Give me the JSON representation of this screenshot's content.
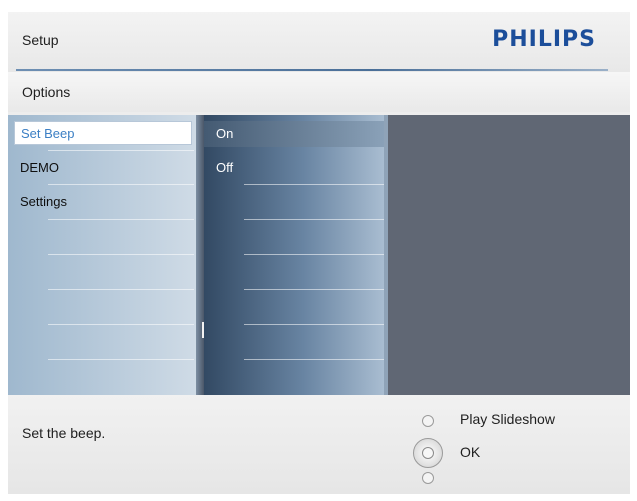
{
  "header": {
    "title": "Setup",
    "brand": "PHILIPS"
  },
  "section": {
    "label": "Options"
  },
  "menu": {
    "items": [
      {
        "label": "Set Beep",
        "selected": true
      },
      {
        "label": "DEMO",
        "selected": false
      },
      {
        "label": "Settings",
        "selected": false
      }
    ]
  },
  "options": {
    "items": [
      {
        "label": "On",
        "highlighted": true
      },
      {
        "label": "Off",
        "highlighted": false
      }
    ]
  },
  "footer": {
    "help": "Set the beep.",
    "play_label": "Play Slideshow",
    "ok_label": "OK"
  },
  "colors": {
    "brand": "#1c4e9a",
    "selected_text": "#3b7fc4"
  }
}
